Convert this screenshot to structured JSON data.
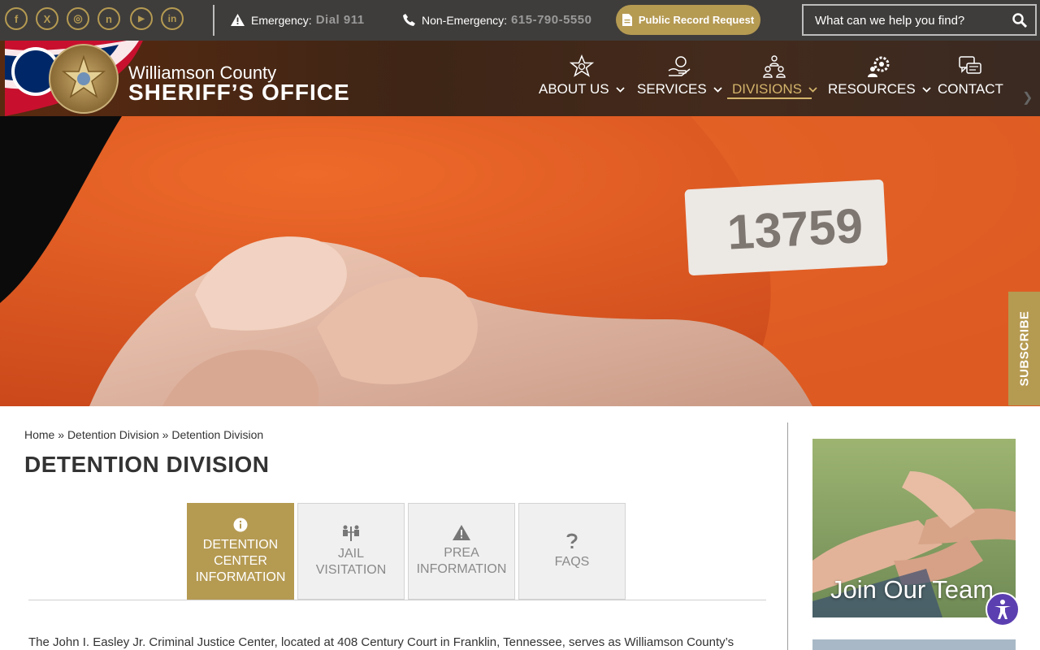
{
  "topbar": {
    "social": [
      {
        "icon": "facebook-icon",
        "glyph": "f"
      },
      {
        "icon": "x-twitter-icon",
        "glyph": "X"
      },
      {
        "icon": "instagram-icon",
        "glyph": "◎"
      },
      {
        "icon": "nextdoor-icon",
        "glyph": "n"
      },
      {
        "icon": "youtube-icon",
        "glyph": "▶"
      },
      {
        "icon": "linkedin-icon",
        "glyph": "in"
      }
    ],
    "emergency_label": "Emergency:",
    "emergency_value": "Dial 911",
    "nonemergency_label": "Non-Emergency:",
    "nonemergency_value": "615-790-5550",
    "public_record_button": "Public Record Request",
    "search_placeholder": "What can we help you find?"
  },
  "brand": {
    "line1": "Williamson County",
    "line2": "SHERIFF’S OFFICE"
  },
  "nav": {
    "items": [
      {
        "label": "ABOUT US",
        "icon": "sheriff-star-icon",
        "has_dropdown": true
      },
      {
        "label": "SERVICES",
        "icon": "helping-hand-icon",
        "has_dropdown": true
      },
      {
        "label": "DIVISIONS",
        "icon": "org-chart-icon",
        "has_dropdown": true,
        "active": true
      },
      {
        "label": "RESOURCES",
        "icon": "gear-people-icon",
        "has_dropdown": true
      },
      {
        "label": "CONTACT",
        "icon": "chat-bubbles-icon",
        "has_dropdown": false
      }
    ]
  },
  "subscribe_label": "SUBSCRIBE",
  "breadcrumb": {
    "home": "Home",
    "sep1": "»",
    "crumb2": "Detention Division",
    "sep2": "»",
    "crumb3": "Detention Division"
  },
  "page_title": "DETENTION DIVISION",
  "tabs": [
    {
      "line1": "DETENTION",
      "line2": "CENTER",
      "line3": "INFORMATION",
      "icon": "info-icon",
      "active": true
    },
    {
      "line1": "JAIL",
      "line2": "VISITATION",
      "icon": "visitation-icon"
    },
    {
      "line1": "PREA",
      "line2": "INFORMATION",
      "icon": "warning-icon"
    },
    {
      "line1": "FAQS",
      "icon": "question-icon"
    }
  ],
  "intro_text": "The John I. Easley Jr. Criminal Justice Center, located at 408 Century Court in Franklin, Tennessee, serves as Williamson County’s",
  "sidebar": {
    "promo_label": "Join Our Team"
  },
  "colors": {
    "gold": "#b59a52",
    "topbar": "#3f3d3b",
    "accessibility": "#5b3fb0"
  }
}
